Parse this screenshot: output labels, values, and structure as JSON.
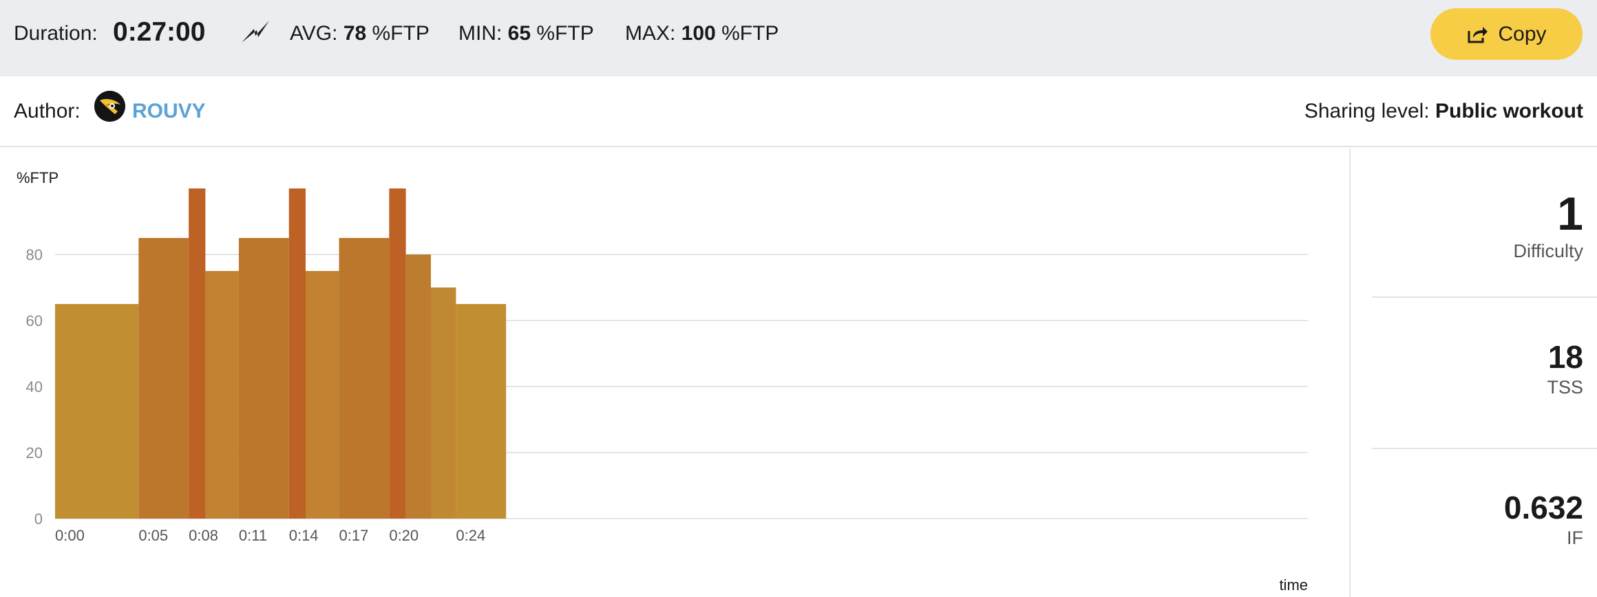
{
  "summary": {
    "duration_label": "Duration:",
    "duration_value": "0:27:00",
    "avg_label": "AVG:",
    "avg_value": "78",
    "min_label": "MIN:",
    "min_value": "65",
    "max_label": "MAX:",
    "max_value": "100",
    "unit": "%FTP",
    "icon": "lightning-bolt-icon"
  },
  "copy_button": {
    "label": "Copy",
    "icon": "share-export-icon",
    "color": "#f6cd45"
  },
  "author": {
    "label": "Author:",
    "name": "ROUVY",
    "name_color": "#5aa3d6"
  },
  "sharing": {
    "label": "Sharing level:",
    "value": "Public workout"
  },
  "metrics": [
    {
      "value": "1",
      "label": "Difficulty"
    },
    {
      "value": "18",
      "label": "TSS"
    },
    {
      "value": "0.632",
      "label": "IF"
    }
  ],
  "chart_data": {
    "type": "bar",
    "ylabel": "%FTP",
    "xlabel": "time",
    "ylim": [
      0,
      100
    ],
    "xlim_minutes": [
      0,
      75
    ],
    "y_ticks": [
      "0",
      "20",
      "40",
      "60",
      "80"
    ],
    "x_ticks": [
      {
        "t": 0,
        "label": "0:00"
      },
      {
        "t": 5,
        "label": "0:05"
      },
      {
        "t": 8,
        "label": "0:08"
      },
      {
        "t": 11,
        "label": "0:11"
      },
      {
        "t": 14,
        "label": "0:14"
      },
      {
        "t": 17,
        "label": "0:17"
      },
      {
        "t": 20,
        "label": "0:20"
      },
      {
        "t": 24,
        "label": "0:24"
      }
    ],
    "grid": true,
    "intervals": [
      {
        "start": 0,
        "end": 5,
        "value": 65,
        "color": "#c18f32"
      },
      {
        "start": 5,
        "end": 8,
        "value": 85,
        "color": "#bd772d"
      },
      {
        "start": 8,
        "end": 9,
        "value": 100,
        "color": "#bd6124"
      },
      {
        "start": 9,
        "end": 11,
        "value": 75,
        "color": "#c18331"
      },
      {
        "start": 11,
        "end": 14,
        "value": 85,
        "color": "#bd772d"
      },
      {
        "start": 14,
        "end": 15,
        "value": 100,
        "color": "#bd6124"
      },
      {
        "start": 15,
        "end": 17,
        "value": 75,
        "color": "#c18331"
      },
      {
        "start": 17,
        "end": 20,
        "value": 85,
        "color": "#bd772d"
      },
      {
        "start": 20,
        "end": 21,
        "value": 100,
        "color": "#bd6124"
      },
      {
        "start": 21,
        "end": 22.5,
        "value": 80,
        "color": "#bd7d2e"
      },
      {
        "start": 22.5,
        "end": 24,
        "value": 70,
        "color": "#c08832"
      },
      {
        "start": 24,
        "end": 27,
        "value": 65,
        "color": "#c18f32"
      }
    ]
  }
}
